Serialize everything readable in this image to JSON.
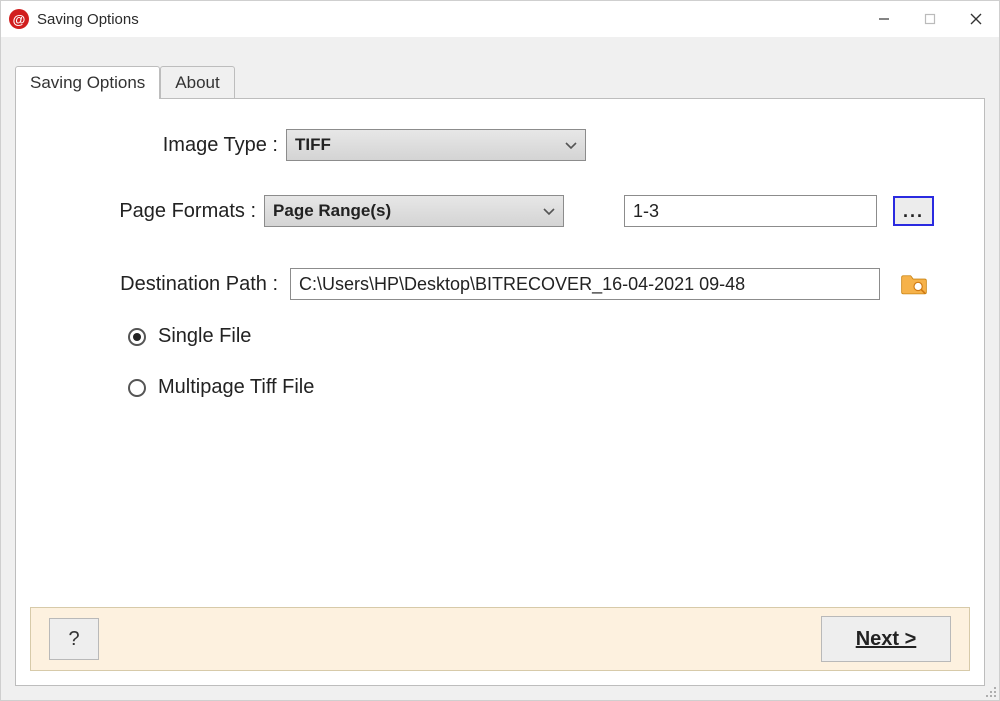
{
  "window": {
    "title": "Saving Options",
    "icon_glyph": "@"
  },
  "tabs": {
    "items": [
      "Saving Options",
      "About"
    ],
    "active_index": 0
  },
  "form": {
    "image_type": {
      "label": "Image Type  :",
      "value": "TIFF"
    },
    "page_formats": {
      "label": "Page Formats  :",
      "value": "Page Range(s)",
      "range_value": "1-3",
      "ellipsis": "..."
    },
    "destination": {
      "label": "Destination Path  :",
      "value": "C:\\Users\\HP\\Desktop\\BITRECOVER_16-04-2021 09-48"
    },
    "output_mode": {
      "options": [
        "Single File",
        "Multipage Tiff File"
      ],
      "selected_index": 0
    }
  },
  "footer": {
    "help": "?",
    "next": "Next >"
  }
}
